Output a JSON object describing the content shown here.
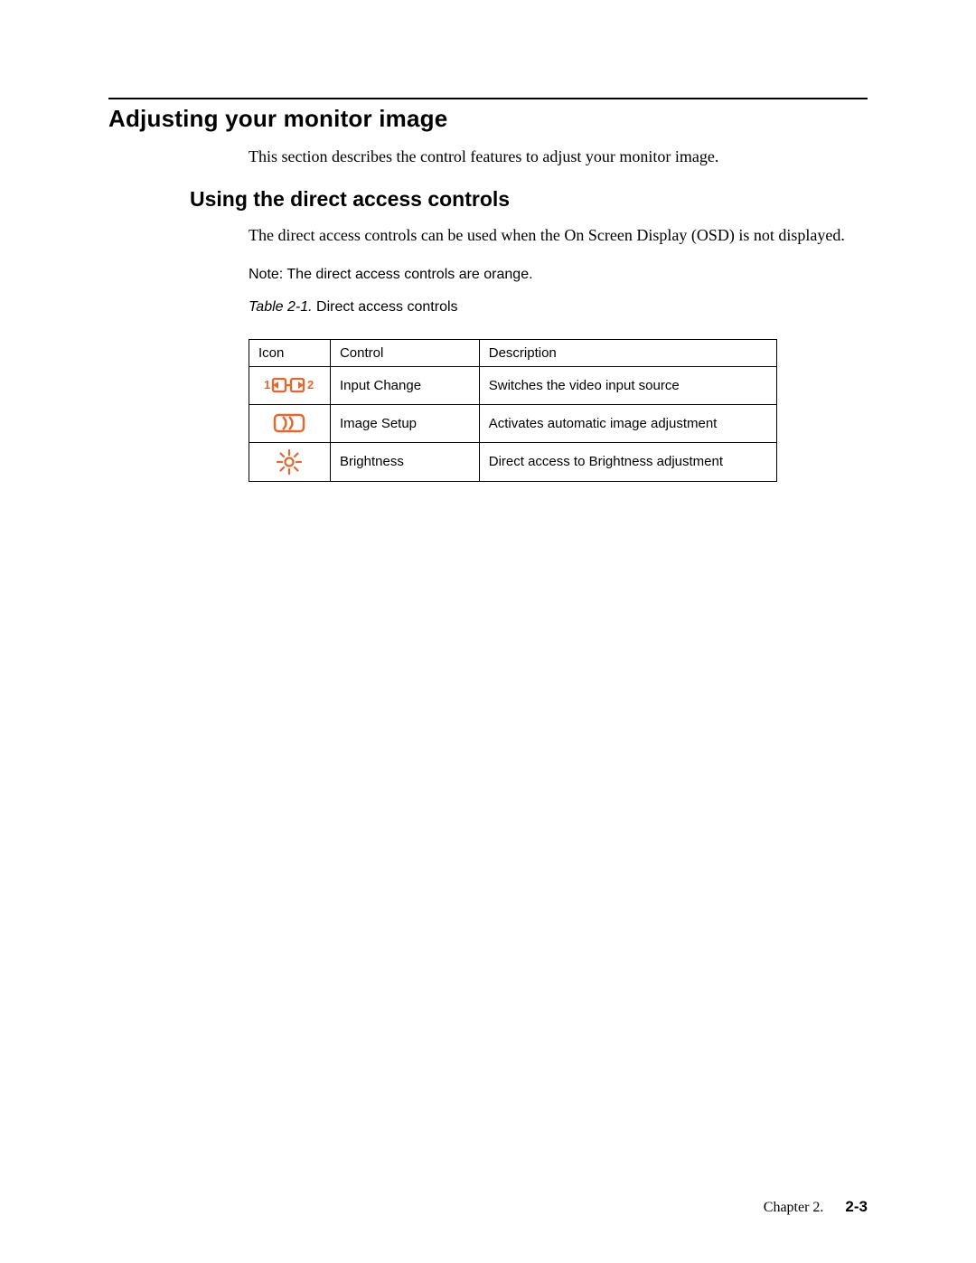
{
  "section": {
    "title": "Adjusting your monitor image",
    "intro": "This section describes the control features to adjust your monitor image."
  },
  "subsection": {
    "title": "Using the direct access controls",
    "intro": "The direct access controls can be used when the On Screen Display (OSD) is not displayed.",
    "note": "Note:  The direct access controls are orange."
  },
  "table": {
    "caption_label": "Table 2-1.",
    "caption_text": " Direct access controls",
    "headers": {
      "icon": "Icon",
      "control": "Control",
      "description": "Description"
    },
    "rows": [
      {
        "icon_name": "input-change-icon",
        "control": "Input  Change",
        "description": "Switches the video input source"
      },
      {
        "icon_name": "image-setup-icon",
        "control": "Image Setup",
        "description": "Activates automatic image adjustment"
      },
      {
        "icon_name": "brightness-icon",
        "control": "Brightness",
        "description": "Direct access to Brightness adjustment"
      }
    ]
  },
  "footer": {
    "chapter": "Chapter 2.",
    "page": "2-3"
  },
  "colors": {
    "accent": "#e8662b"
  }
}
